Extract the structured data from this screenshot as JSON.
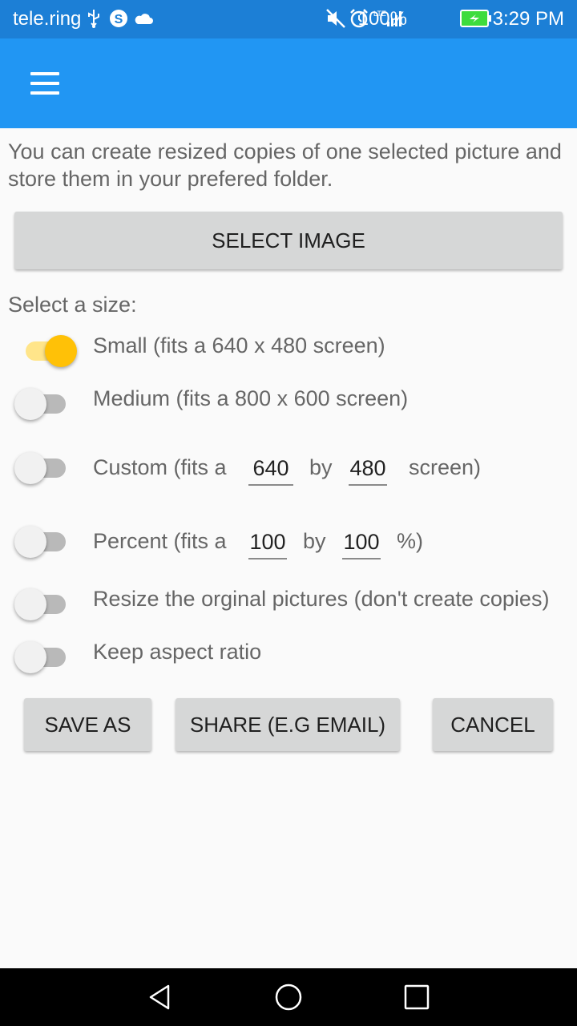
{
  "status_bar": {
    "carrier": "tele.ring",
    "battery": "100%",
    "time": "3:29 PM",
    "icons": [
      "usb-icon",
      "skype-icon",
      "cloud-icon",
      "mute-icon",
      "alarm-icon",
      "lte-signal-icon",
      "battery-charging-icon"
    ]
  },
  "app_bar": {
    "menu_icon": "hamburger-menu-icon",
    "color": "#2196f3"
  },
  "intro_text": "You can create resized copies of one selected picture and store them in your prefered folder.",
  "select_image_label": "SELECT IMAGE",
  "size_label": "Select a size:",
  "options": {
    "small": {
      "label": "Small (fits a 640 x 480 screen)",
      "on": true
    },
    "medium": {
      "label": "Medium (fits a 800 x 600 screen)",
      "on": false
    },
    "custom": {
      "prefix": "Custom (fits a",
      "width": "640",
      "by": "by",
      "height": "480",
      "suffix": "screen)",
      "on": false
    },
    "percent": {
      "prefix": "Percent (fits a",
      "width": "100",
      "by": "by",
      "height": "100",
      "suffix": "%)",
      "on": false
    },
    "resize_original": {
      "label": "Resize the orginal pictures (don't create copies)",
      "on": false
    },
    "keep_aspect": {
      "label": "Keep aspect ratio",
      "on": false
    }
  },
  "buttons": {
    "save_as": "SAVE AS",
    "share": "SHARE (E.G EMAIL)",
    "cancel": "CANCEL"
  },
  "accent_color": "#ffc107",
  "nav_bar": {
    "icons": [
      "back-icon",
      "home-icon",
      "recents-icon"
    ]
  }
}
